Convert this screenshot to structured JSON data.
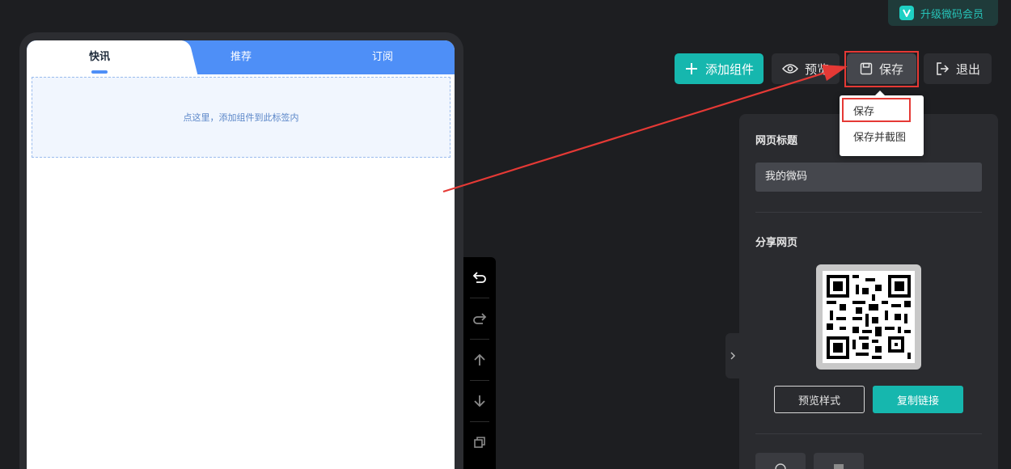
{
  "upgrade": {
    "label": "升级微码会员",
    "icon": "v-logo-icon"
  },
  "phone": {
    "tabs": [
      {
        "label": "快讯",
        "active": true
      },
      {
        "label": "推荐",
        "active": false
      },
      {
        "label": "订阅",
        "active": false
      }
    ],
    "dropzone_text": "点这里，添加组件到此标签内"
  },
  "vtoolbar": {
    "icons": [
      "undo-icon",
      "redo-icon",
      "move-up-icon",
      "move-down-icon",
      "copy-icon"
    ]
  },
  "actions": {
    "add_label": "添加组件",
    "preview_label": "预览",
    "save_label": "保存",
    "exit_label": "退出"
  },
  "save_dropdown": {
    "items": [
      "保存",
      "保存并截图"
    ]
  },
  "panel": {
    "title_label": "网页标题",
    "title_value": "我的微码",
    "share_label": "分享网页",
    "preview_style_label": "预览样式",
    "copy_link_label": "复制链接"
  },
  "colors": {
    "accent": "#16b7ae",
    "tab_blue": "#4e8ff7",
    "highlight_red": "#e53935",
    "background": "#1d1e21"
  }
}
